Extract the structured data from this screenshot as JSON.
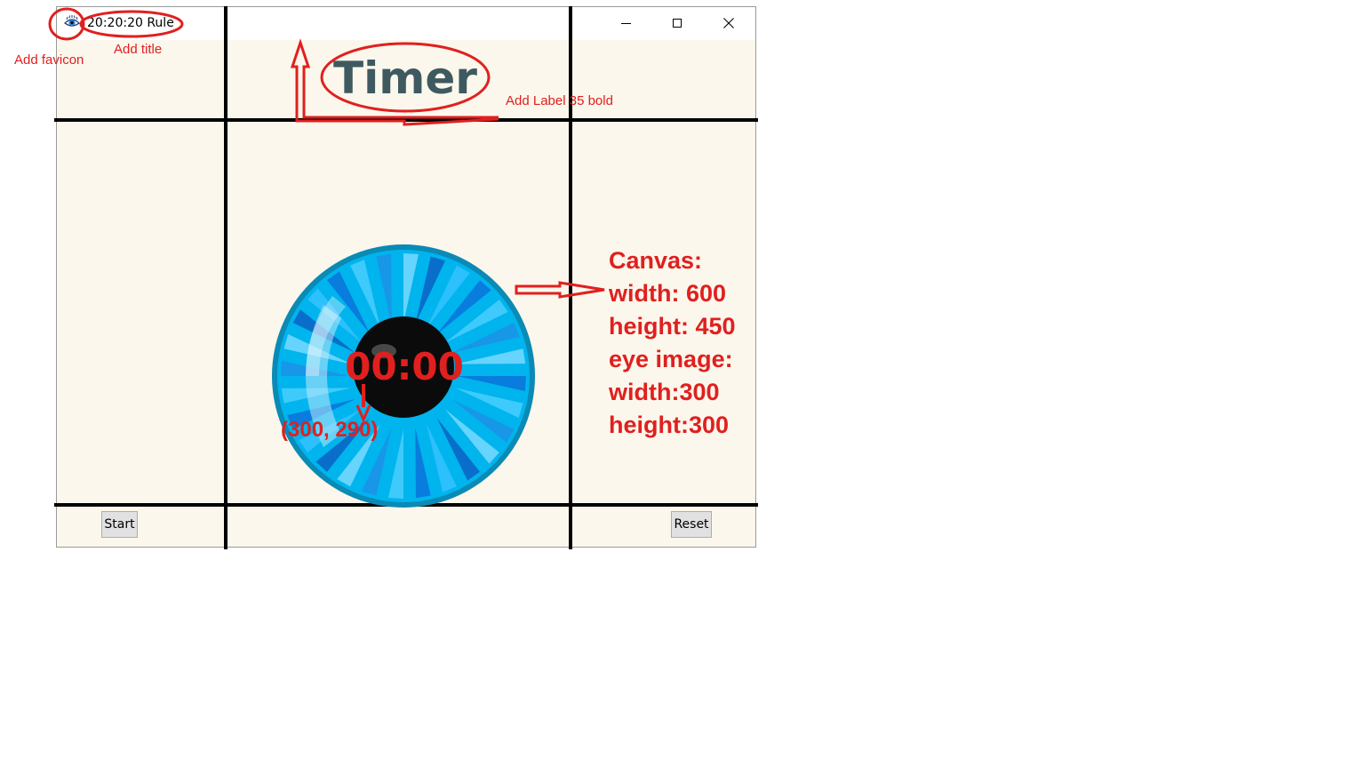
{
  "window": {
    "title": "20:20:20 Rule",
    "favicon": "eye-icon",
    "controls": {
      "minimize": "minimize-icon",
      "maximize": "maximize-icon",
      "close": "close-icon"
    }
  },
  "main": {
    "heading": "Timer",
    "timer_text": "00:00",
    "start_label": "Start",
    "reset_label": "Reset",
    "colors": {
      "background": "#fbf7ec",
      "heading": "#3e5a60",
      "timer": "#e0201f",
      "iris": "#00b4ee",
      "pupil": "#0b0b0b"
    }
  },
  "annotations": {
    "favicon_note": "Add favicon",
    "title_note": "Add title",
    "label_note": "Add Label 35 bold",
    "coord_note": "(300, 290)",
    "canvas_notes": [
      "Canvas:",
      "width: 600",
      "height: 450",
      "eye image:",
      "width:300",
      "height:300"
    ],
    "color": "#e0201f"
  }
}
